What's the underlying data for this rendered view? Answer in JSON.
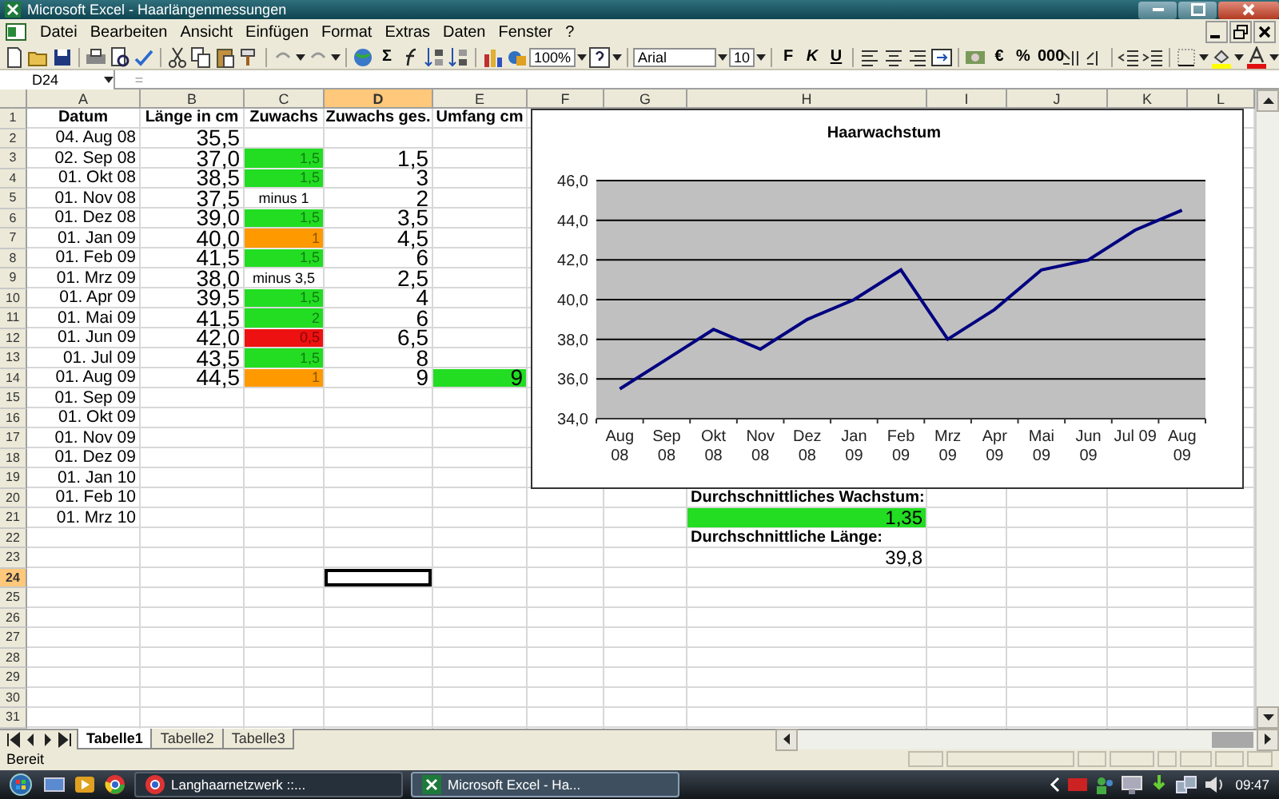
{
  "window": {
    "title": "Microsoft Excel - Haarlängenmessungen"
  },
  "menu": [
    "Datei",
    "Bearbeiten",
    "Ansicht",
    "Einfügen",
    "Format",
    "Extras",
    "Daten",
    "Fenster",
    "?"
  ],
  "toolbar": {
    "sum": "Σ",
    "zoom": "100%",
    "font": "Arial",
    "size": "10",
    "format_buttons": [
      "F",
      "K",
      "U"
    ],
    "number_buttons": [
      "€",
      "%",
      "000"
    ]
  },
  "formula_bar": {
    "name_box": "D24",
    "sign": "="
  },
  "columns": [
    {
      "label": "A",
      "selected": false
    },
    {
      "label": "B",
      "selected": false
    },
    {
      "label": "C",
      "selected": false
    },
    {
      "label": "D",
      "selected": true
    },
    {
      "label": "E",
      "selected": false
    },
    {
      "label": "F",
      "selected": false
    },
    {
      "label": "G",
      "selected": false
    },
    {
      "label": "H",
      "selected": false
    },
    {
      "label": "I",
      "selected": false
    },
    {
      "label": "J",
      "selected": false
    },
    {
      "label": "K",
      "selected": false
    },
    {
      "label": "L",
      "selected": false
    }
  ],
  "rows": [
    {
      "number": "1",
      "selected": false,
      "cells": [
        {
          "kind": "header",
          "text": "Datum"
        },
        {
          "kind": "header",
          "text": "Länge in cm"
        },
        {
          "kind": "header",
          "text": "Zuwachs"
        },
        {
          "kind": "header",
          "text": "Zuwachs ges."
        },
        {
          "kind": "header",
          "text": "Umfang cm"
        }
      ]
    },
    {
      "number": "2",
      "selected": false,
      "cells": [
        {
          "kind": "date",
          "text": "04. Aug 08"
        },
        {
          "kind": "large",
          "text": "35,5"
        }
      ]
    },
    {
      "number": "3",
      "selected": false,
      "cells": [
        {
          "kind": "date",
          "text": "02. Sep 08"
        },
        {
          "kind": "large",
          "text": "37,0"
        },
        {
          "kind": "small",
          "text": "1,5",
          "color": "#22dd22"
        },
        {
          "kind": "large",
          "text": "1,5"
        }
      ]
    },
    {
      "number": "4",
      "selected": false,
      "cells": [
        {
          "kind": "date",
          "text": "01. Okt 08"
        },
        {
          "kind": "large",
          "text": "38,5"
        },
        {
          "kind": "small",
          "text": "1,5",
          "color": "#22dd22"
        },
        {
          "kind": "large",
          "text": "3"
        }
      ]
    },
    {
      "number": "5",
      "selected": false,
      "cells": [
        {
          "kind": "date",
          "text": "01. Nov 08"
        },
        {
          "kind": "large",
          "text": "37,5"
        },
        {
          "kind": "note",
          "text": "minus 1"
        },
        {
          "kind": "large",
          "text": "2"
        }
      ]
    },
    {
      "number": "6",
      "selected": false,
      "cells": [
        {
          "kind": "date",
          "text": "01. Dez 08"
        },
        {
          "kind": "large",
          "text": "39,0"
        },
        {
          "kind": "small",
          "text": "1,5",
          "color": "#22dd22"
        },
        {
          "kind": "large",
          "text": "3,5"
        }
      ]
    },
    {
      "number": "7",
      "selected": false,
      "cells": [
        {
          "kind": "date",
          "text": "01. Jan 09"
        },
        {
          "kind": "large",
          "text": "40,0"
        },
        {
          "kind": "small",
          "text": "1",
          "color": "#ff9900"
        },
        {
          "kind": "large",
          "text": "4,5"
        }
      ]
    },
    {
      "number": "8",
      "selected": false,
      "cells": [
        {
          "kind": "date",
          "text": "01. Feb 09"
        },
        {
          "kind": "large",
          "text": "41,5"
        },
        {
          "kind": "small",
          "text": "1,5",
          "color": "#22dd22"
        },
        {
          "kind": "large",
          "text": "6"
        }
      ]
    },
    {
      "number": "9",
      "selected": false,
      "cells": [
        {
          "kind": "date",
          "text": "01. Mrz 09"
        },
        {
          "kind": "large",
          "text": "38,0"
        },
        {
          "kind": "note",
          "text": "minus 3,5"
        },
        {
          "kind": "large",
          "text": "2,5"
        }
      ]
    },
    {
      "number": "10",
      "selected": false,
      "cells": [
        {
          "kind": "date",
          "text": "01. Apr 09"
        },
        {
          "kind": "large",
          "text": "39,5"
        },
        {
          "kind": "small",
          "text": "1,5",
          "color": "#22dd22"
        },
        {
          "kind": "large",
          "text": "4"
        }
      ]
    },
    {
      "number": "11",
      "selected": false,
      "cells": [
        {
          "kind": "date",
          "text": "01. Mai 09"
        },
        {
          "kind": "large",
          "text": "41,5"
        },
        {
          "kind": "small",
          "text": "2",
          "color": "#22dd22"
        },
        {
          "kind": "large",
          "text": "6"
        }
      ]
    },
    {
      "number": "12",
      "selected": false,
      "cells": [
        {
          "kind": "date",
          "text": "01. Jun 09"
        },
        {
          "kind": "large",
          "text": "42,0"
        },
        {
          "kind": "small",
          "text": "0,5",
          "color": "#ee1111"
        },
        {
          "kind": "large",
          "text": "6,5"
        }
      ]
    },
    {
      "number": "13",
      "selected": false,
      "cells": [
        {
          "kind": "date",
          "text": "01. Jul 09"
        },
        {
          "kind": "large",
          "text": "43,5"
        },
        {
          "kind": "small",
          "text": "1,5",
          "color": "#22dd22"
        },
        {
          "kind": "large",
          "text": "8"
        }
      ]
    },
    {
      "number": "14",
      "selected": false,
      "cells": [
        {
          "kind": "date",
          "text": "01. Aug 09"
        },
        {
          "kind": "large",
          "text": "44,5"
        },
        {
          "kind": "small",
          "text": "1",
          "color": "#ff9900"
        },
        {
          "kind": "large",
          "text": "9"
        },
        {
          "kind": "large",
          "text": "9",
          "color": "#22dd22"
        }
      ]
    },
    {
      "number": "15",
      "selected": false,
      "cells": [
        {
          "kind": "date",
          "text": "01. Sep 09"
        }
      ]
    },
    {
      "number": "16",
      "selected": false,
      "cells": [
        {
          "kind": "date",
          "text": "01. Okt 09"
        }
      ]
    },
    {
      "number": "17",
      "selected": false,
      "cells": [
        {
          "kind": "date",
          "text": "01. Nov 09"
        }
      ]
    },
    {
      "number": "18",
      "selected": false,
      "cells": [
        {
          "kind": "date",
          "text": "01. Dez 09"
        }
      ]
    },
    {
      "number": "19",
      "selected": false,
      "cells": [
        {
          "kind": "date",
          "text": "01. Jan 10"
        }
      ]
    },
    {
      "number": "20",
      "selected": false,
      "cells": [
        {
          "kind": "date",
          "text": "01. Feb 10"
        },
        null,
        null,
        null,
        null,
        null,
        null,
        {
          "kind": "label",
          "text": "Durchschnittliches Wachstum:"
        }
      ]
    },
    {
      "number": "21",
      "selected": false,
      "cells": [
        {
          "kind": "date",
          "text": "01. Mrz 10"
        },
        null,
        null,
        null,
        null,
        null,
        null,
        {
          "kind": "value",
          "text": "1,35",
          "color": "#22dd22"
        }
      ]
    },
    {
      "number": "22",
      "selected": false,
      "cells": [
        null,
        null,
        null,
        null,
        null,
        null,
        null,
        {
          "kind": "label",
          "text": "Durchschnittliche Länge:"
        }
      ]
    },
    {
      "number": "23",
      "selected": false,
      "cells": [
        null,
        null,
        null,
        null,
        null,
        null,
        null,
        {
          "kind": "value",
          "text": "39,8"
        }
      ]
    },
    {
      "number": "24",
      "selected": true
    },
    {
      "number": "25",
      "selected": false
    },
    {
      "number": "26",
      "selected": false
    },
    {
      "number": "27",
      "selected": false
    },
    {
      "number": "28",
      "selected": false
    },
    {
      "number": "29",
      "selected": false
    },
    {
      "number": "30",
      "selected": false
    },
    {
      "number": "31",
      "selected": false
    }
  ],
  "chart": {
    "chart_data": {
      "type": "line",
      "title": "Haarwachstum",
      "grid": true,
      "categories": [
        "Aug 08",
        "Sep 08",
        "Okt 08",
        "Nov 08",
        "Dez 08",
        "Jan 09",
        "Feb 09",
        "Mrz 09",
        "Apr 09",
        "Mai 09",
        "Jun 09",
        "Jul 09",
        "Aug 09"
      ],
      "series": [
        {
          "color": "#000080",
          "values": [
            35.5,
            37,
            38.5,
            37.5,
            39,
            40,
            41.5,
            38,
            39.5,
            41.5,
            42,
            43.5,
            44.5
          ]
        }
      ],
      "ylim": [
        34,
        46
      ],
      "yticks": [
        {
          "value": 34,
          "label": "34,0"
        },
        {
          "value": 36,
          "label": "36,0"
        },
        {
          "value": 38,
          "label": "38,0"
        },
        {
          "value": 40,
          "label": "40,0"
        },
        {
          "value": 42,
          "label": "42,0"
        },
        {
          "value": 44,
          "label": "44,0"
        },
        {
          "value": 46,
          "label": "46,0"
        }
      ]
    }
  },
  "sheet_tabs": [
    {
      "label": "Tabelle1",
      "selected": true
    },
    {
      "label": "Tabelle2",
      "selected": false
    },
    {
      "label": "Tabelle3",
      "selected": false
    }
  ],
  "status_bar": {
    "text": "Bereit"
  },
  "taskbar": {
    "buttons": [
      {
        "label": "Langhaarnetzwerk ::...",
        "selected": false
      },
      {
        "label": "Microsoft Excel - Ha...",
        "selected": true
      }
    ],
    "clock": "09:47"
  }
}
